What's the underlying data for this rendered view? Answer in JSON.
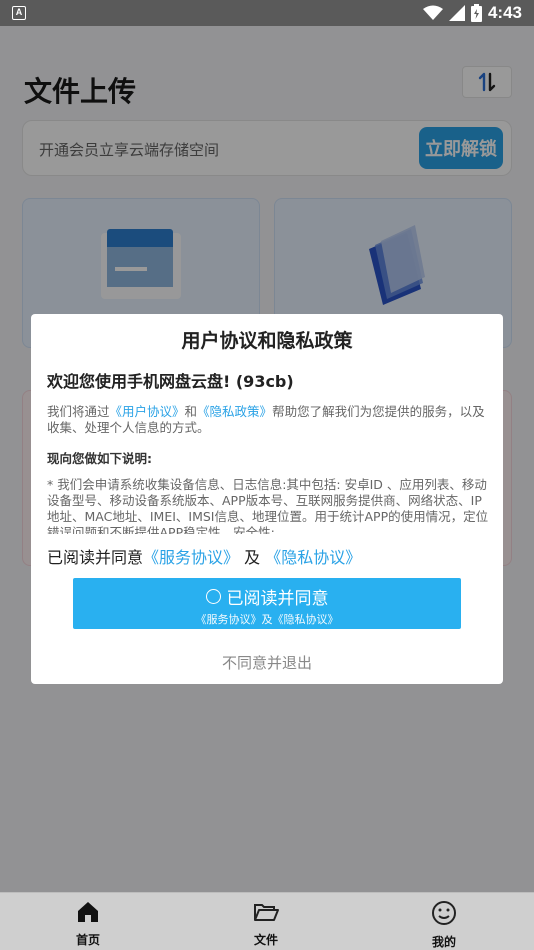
{
  "status_bar": {
    "time": "4:43",
    "app_icon_letter": "A"
  },
  "page": {
    "title": "文件上传",
    "promo_text": "开通会员立享云端存储空间",
    "unlock_label": "立即解锁"
  },
  "dialog": {
    "title": "用户协议和隐私政策",
    "welcome": "欢迎您使用手机网盘云盘! (93cb)",
    "intro_pre": "我们将通过",
    "user_agreement_link": "《用户协议》",
    "intro_and": "和",
    "privacy_link": "《隐私政策》",
    "intro_post": "帮助您了解我们为您提供的服务，以及收集、处理个人信息的方式。",
    "section_heading": "现向您做如下说明:",
    "detail": "* 我们会申请系统收集设备信息、日志信息:其中包括: 安卓ID 、应用列表、移动设备型号、移动设备系统版本、APP版本号、互联网服务提供商、网络状态、IP地址、MAC地址、IMEI、IMSI信息、地理位置。用于统计APP的使用情况，定位错误问题和不断提供APP稳定性、安全性;",
    "agree_line_pre": "已阅读并同意",
    "service_link": "《服务协议》",
    "agree_line_and": "及",
    "privacy_link2": "《隐私协议》",
    "agree_button_label": "已阅读并同意",
    "agree_button_sub": "《服务协议》及《隐私协议》",
    "decline_label": "不同意并退出"
  },
  "tabs": [
    {
      "label": "首页",
      "icon": "home-icon"
    },
    {
      "label": "文件",
      "icon": "folder-open-icon"
    },
    {
      "label": "我的",
      "icon": "smile-icon"
    }
  ]
}
